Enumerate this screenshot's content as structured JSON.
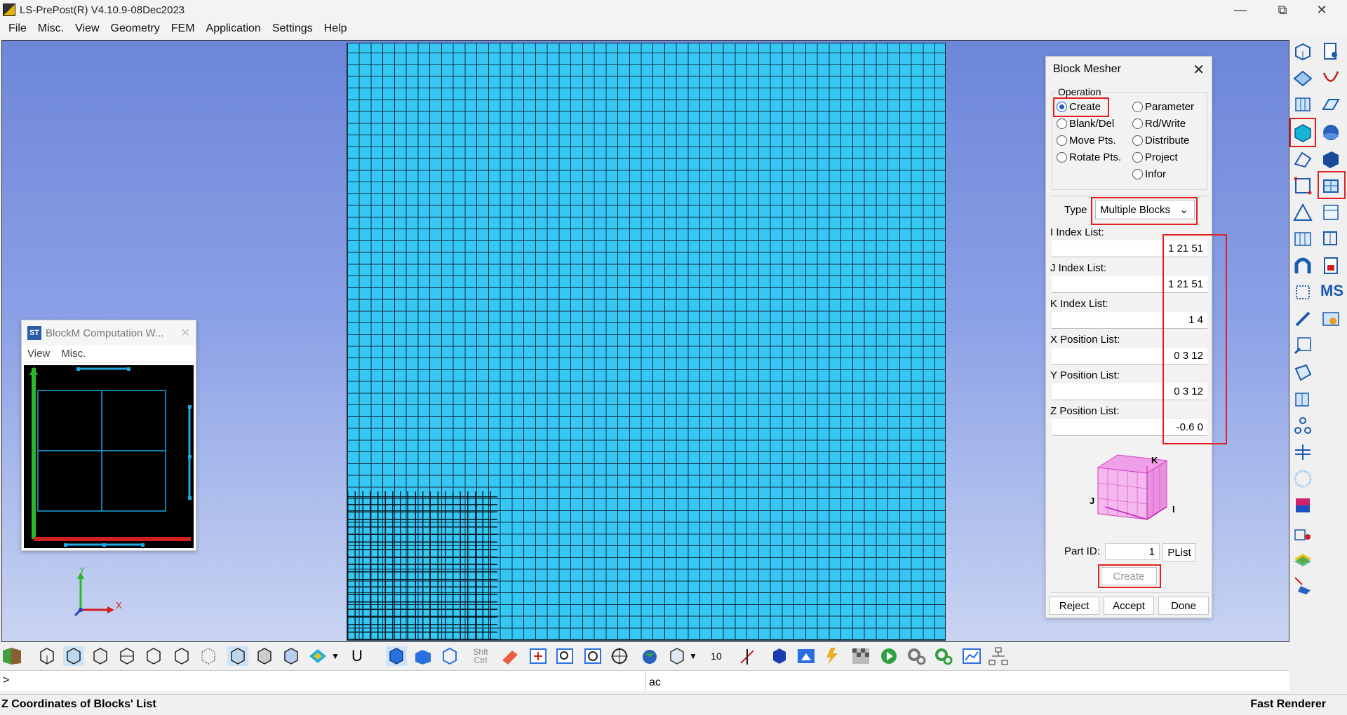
{
  "window": {
    "title": "LS-PrePost(R) V4.10.9-08Dec2023"
  },
  "menubar": [
    "File",
    "Misc.",
    "View",
    "Geometry",
    "FEM",
    "Application",
    "Settings",
    "Help"
  ],
  "block_mesher": {
    "title": "Block Mesher",
    "operation_label": "Operation",
    "operations_left": [
      "Create",
      "Blank/Del",
      "Move Pts.",
      "Rotate Pts."
    ],
    "operations_right": [
      "Parameter",
      "Rd/Write",
      "Distribute",
      "Project",
      "Infor"
    ],
    "selected_operation": "Create",
    "type_label": "Type",
    "type_value": "Multiple Blocks",
    "fields": [
      {
        "label": "I Index List:",
        "value": "1 21 51"
      },
      {
        "label": "J Index List:",
        "value": "1 21 51"
      },
      {
        "label": "K Index List:",
        "value": "1 4"
      },
      {
        "label": "X Position List:",
        "value": "0 3 12"
      },
      {
        "label": "Y Position List:",
        "value": "0 3 12"
      },
      {
        "label": "Z Position List:",
        "value": "-0.6 0"
      }
    ],
    "axis_labels": {
      "k": "K",
      "j": "J",
      "i": "I"
    },
    "part_id_label": "Part ID:",
    "part_id_value": "1",
    "plist_label": "PList",
    "create_button": "Create",
    "reject_button": "Reject",
    "accept_button": "Accept",
    "done_button": "Done"
  },
  "computation_window": {
    "title": "BlockM Computation W...",
    "logo": "ST",
    "menu": [
      "View",
      "Misc."
    ]
  },
  "triad": {
    "y": "Y",
    "x": "X"
  },
  "bottom_toolbar": {
    "shift_ctrl_line1": "Shft",
    "shift_ctrl_line2": "Ctrl",
    "u_label": "U",
    "count_value": "10"
  },
  "command_line": {
    "prompt": ">",
    "input_text": "ac"
  },
  "status_bar": {
    "left": "Z Coordinates of Blocks' List",
    "right": "Fast Renderer"
  },
  "colors": {
    "mesh": "#37c7f5",
    "highlight": "#e02020",
    "viewport_top": "#6d86d8"
  }
}
